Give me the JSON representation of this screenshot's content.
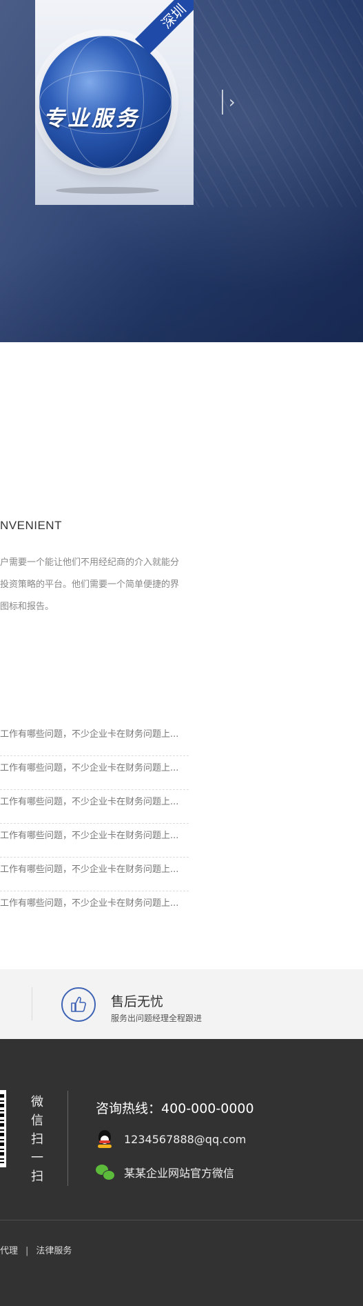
{
  "hero": {
    "book_ribbon": "深圳",
    "book_title": "专业服务",
    "next_icon": "chevron-right-icon"
  },
  "about": {
    "subtitle": "NVENIENT",
    "paragraph": "户需要一个能让他们不用经纪商的介入就能分\n投资策略的平台。他们需要一个简单便捷的界\n图标和报告。"
  },
  "news": {
    "items": [
      "工作有哪些问题，不少企业卡在财务问题上...",
      "工作有哪些问题，不少企业卡在财务问题上...",
      "工作有哪些问题，不少企业卡在财务问题上...",
      "工作有哪些问题，不少企业卡在财务问题上...",
      "工作有哪些问题，不少企业卡在财务问题上...",
      "工作有哪些问题，不少企业卡在财务问题上..."
    ]
  },
  "service": {
    "icon": "thumbs-up-icon",
    "title": "售后无忧",
    "subtitle": "服务出问题经理全程跟进",
    "accent": "#3e63b5"
  },
  "footer": {
    "wechat_scan": [
      "微",
      "信",
      "扫",
      "一",
      "扫"
    ],
    "hotline": "咨询热线：400-000-0000",
    "qq": "1234567888@qq.com",
    "wechat": "某某企业网站官方微信",
    "links": [
      "代理",
      "法律服务"
    ],
    "link_separator": "|",
    "background": "#323232"
  }
}
